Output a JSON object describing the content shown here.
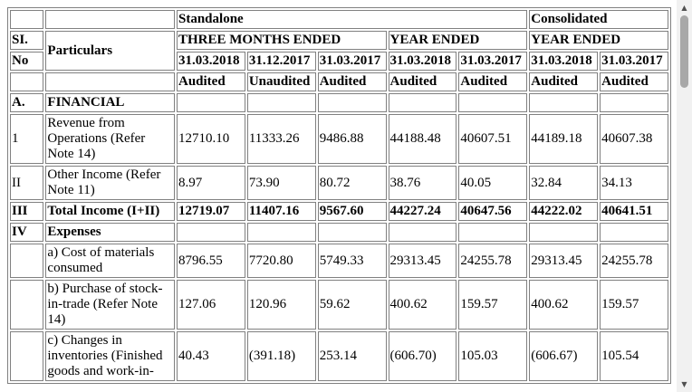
{
  "header": {
    "standalone": "Standalone",
    "consolidated": "Consolidated",
    "si": "SI.",
    "no": "No",
    "particulars": "Particulars",
    "three_months": "THREE MONTHS ENDED",
    "year_ended_s": "YEAR ENDED",
    "year_ended_c": "YEAR ENDED",
    "dates": [
      "31.03.2018",
      "31.12.2017",
      "31.03.2017",
      "31.03.2018",
      "31.03.2017",
      "31.03.2018",
      "31.03.2017"
    ],
    "status": [
      "Audited",
      "Unaudited",
      "Audited",
      "Audited",
      "Audited",
      "Audited",
      "Audited"
    ]
  },
  "rows": [
    {
      "no": "A.",
      "particular": "FINANCIAL",
      "values": [
        "",
        "",
        "",
        "",
        "",
        "",
        ""
      ]
    },
    {
      "no": "1",
      "particular": "Revenue from Operations (Refer Note 14)",
      "values": [
        "12710.10",
        "11333.26",
        "9486.88",
        "44188.48",
        "40607.51",
        "44189.18",
        "40607.38"
      ]
    },
    {
      "no": "II",
      "particular": "Other Income (Refer Note 11)",
      "values": [
        "8.97",
        "73.90",
        "80.72",
        "38.76",
        "40.05",
        "32.84",
        "34.13"
      ]
    },
    {
      "no": "III",
      "particular": "Total Income (I+II)",
      "values": [
        "12719.07",
        "11407.16",
        "9567.60",
        "44227.24",
        "40647.56",
        "44222.02",
        "40641.51"
      ]
    },
    {
      "no": "IV",
      "particular": "Expenses",
      "values": [
        "",
        "",
        "",
        "",
        "",
        "",
        ""
      ]
    },
    {
      "no": "",
      "particular": "a) Cost of materials consumed",
      "values": [
        "8796.55",
        "7720.80",
        "5749.33",
        "29313.45",
        "24255.78",
        "29313.45",
        "24255.78"
      ]
    },
    {
      "no": "",
      "particular": "b) Purchase of stock-in-trade (Refer Note 14)",
      "values": [
        "127.06",
        "120.96",
        "59.62",
        "400.62",
        "159.57",
        "400.62",
        "159.57"
      ]
    },
    {
      "no": "",
      "particular": "c) Changes in inventories (Finished goods and work-in-",
      "values": [
        "40.43",
        "(391.18)",
        "253.14",
        "(606.70)",
        "105.03",
        "(606.67)",
        "105.54"
      ]
    }
  ]
}
